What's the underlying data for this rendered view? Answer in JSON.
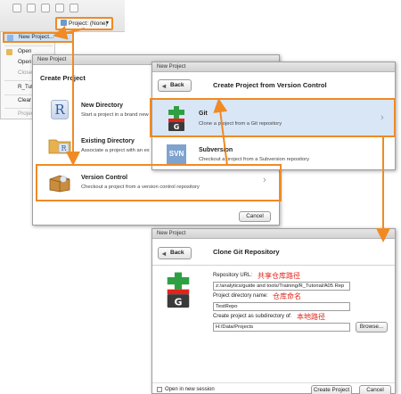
{
  "toolbar": {
    "project_label": "Project: (None)"
  },
  "menu": {
    "items": [
      {
        "label": "New Project...",
        "state": "active"
      },
      {
        "label": "Open ",
        "state": "normal"
      },
      {
        "label": "Open ",
        "state": "normal"
      },
      {
        "label": "Close",
        "state": "dim"
      },
      {
        "label": "R_Tutori",
        "state": "normal"
      },
      {
        "label": "Clear ",
        "state": "normal"
      },
      {
        "label": "Project",
        "state": "dim"
      }
    ]
  },
  "dialog_create": {
    "window_title": "New Project",
    "heading": "Create Project",
    "options": [
      {
        "title": "New Directory",
        "desc": "Start a project in a brand new"
      },
      {
        "title": "Existing Directory",
        "desc": "Associate a project with an ex"
      },
      {
        "title": "Version Control",
        "desc": "Checkout a project from a version control repository"
      }
    ],
    "cancel": "Cancel"
  },
  "dialog_vcs": {
    "window_title": "New Project",
    "back": "Back",
    "heading": "Create Project from Version Control",
    "options": [
      {
        "title": "Git",
        "desc": "Clone a project from a Git repository"
      },
      {
        "title": "Subversion",
        "desc": "Checkout a project from a Subversion repository",
        "icon_text": "SVN"
      }
    ]
  },
  "dialog_clone": {
    "window_title": "New Project",
    "back": "Back",
    "heading": "Clone Git Repository",
    "repo_label": "Repository URL:",
    "repo_value": "z:/analytics/guide and tools/Training/R_Tutorial/A05 Rep",
    "repo_anno": "共享仓库路径",
    "dir_label": "Project directory name:",
    "dir_value": "TestRepo",
    "dir_anno": "仓库命名",
    "parent_label": "Create project as subdirectory of:",
    "parent_value": "H:/Data/Projects",
    "parent_anno": "本地路径",
    "browse": "Browse...",
    "new_session": "Open in new session",
    "create": "Create Project",
    "cancel": "Cancel"
  },
  "colors": {
    "highlight": "#f08a24",
    "annotation": "#e0241b",
    "selected_row": "#d9e6f5"
  }
}
